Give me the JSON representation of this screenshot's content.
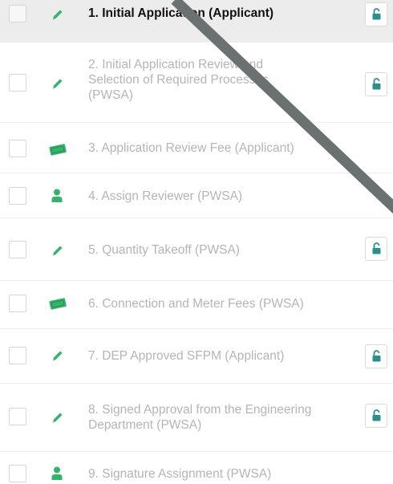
{
  "colors": {
    "accent_green": "#37b26c",
    "lock_teal": "#2e8f8a",
    "active_row_bg": "#ececec",
    "inactive_text": "#b5b5b5",
    "active_text": "#111111"
  },
  "steps": [
    {
      "label": "1. Initial Application (Applicant)",
      "icon": "pencil-icon",
      "locked": true,
      "active": true
    },
    {
      "label": "2. Initial Application Review and Selection of Required Processes (PWSA)",
      "icon": "pencil-icon",
      "locked": true,
      "active": false
    },
    {
      "label": "3. Application Review Fee (Applicant)",
      "icon": "money-icon",
      "locked": false,
      "active": false
    },
    {
      "label": "4. Assign Reviewer (PWSA)",
      "icon": "user-icon",
      "locked": false,
      "active": false
    },
    {
      "label": "5. Quantity Takeoff (PWSA)",
      "icon": "pencil-icon",
      "locked": true,
      "active": false
    },
    {
      "label": "6. Connection and Meter Fees (PWSA)",
      "icon": "money-icon",
      "locked": false,
      "active": false
    },
    {
      "label": "7. DEP Approved SFPM (Applicant)",
      "icon": "pencil-icon",
      "locked": true,
      "active": false
    },
    {
      "label": "8. Signed Approval from the Engineering Department (PWSA)",
      "icon": "pencil-icon",
      "locked": true,
      "active": false
    },
    {
      "label": "9. Signature Assignment (PWSA)",
      "icon": "user-icon",
      "locked": false,
      "active": false
    }
  ]
}
